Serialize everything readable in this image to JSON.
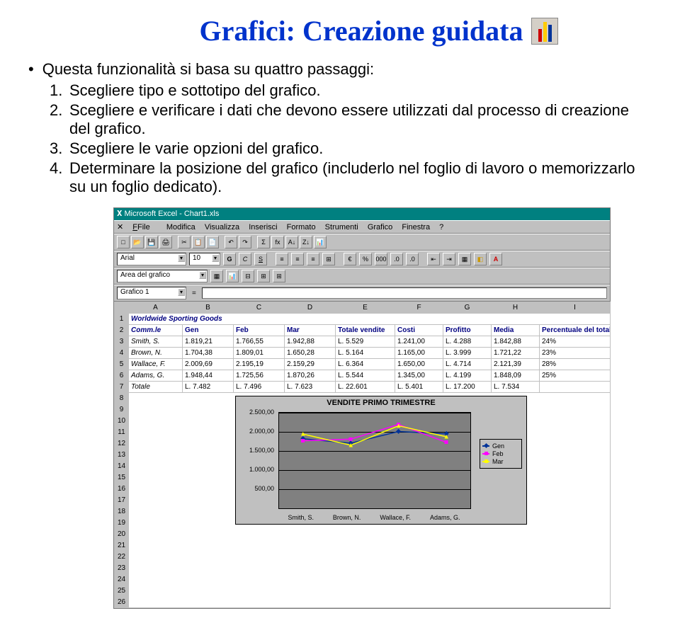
{
  "title": "Grafici: Creazione guidata",
  "intro": "Questa funzionalità si basa su quattro passaggi:",
  "steps": {
    "n1": "1.",
    "t1": "Scegliere tipo e sottotipo del grafico.",
    "n2": "2.",
    "t2": "Scegliere e verificare i dati che devono essere utilizzati dal processo di creazione del grafico.",
    "n3": "3.",
    "t3": "Scegliere le varie opzioni del grafico.",
    "n4": "4.",
    "t4": "Determinare la posizione del grafico (includerlo nel foglio di lavoro o memorizzarlo su un foglio dedicato)."
  },
  "excel": {
    "title": "Microsoft Excel - Chart1.xls",
    "menu": {
      "file": "File",
      "mod": "Modifica",
      "vis": "Visualizza",
      "ins": "Inserisci",
      "form": "Formato",
      "strum": "Strumenti",
      "graf": "Grafico",
      "fin": "Finestra",
      "help": "?"
    },
    "font_name": "Arial",
    "font_size": "10",
    "area_label": "Area del grafico",
    "name_box": "Grafico 1",
    "cols": {
      "a": "A",
      "b": "B",
      "c": "C",
      "d": "D",
      "e": "E",
      "f": "F",
      "g": "G",
      "h": "H",
      "i": "I"
    },
    "r1_a": "Worldwide Sporting Goods",
    "hdr": {
      "a": "Comm.le",
      "b": "Gen",
      "c": "Feb",
      "d": "Mar",
      "e": "Totale vendite",
      "f": "Costi",
      "g": "Profitto",
      "h": "Media",
      "i": "Percentuale del totale"
    },
    "rows": {
      "r3": {
        "a": "Smith, S.",
        "b": "1.819,21",
        "c": "1.766,55",
        "d": "1.942,88",
        "e": "L. 5.529",
        "f": "1.241,00",
        "g": "L. 4.288",
        "h": "1.842,88",
        "i": "24%"
      },
      "r4": {
        "a": "Brown, N.",
        "b": "1.704,38",
        "c": "1.809,01",
        "d": "1.650,28",
        "e": "L. 5.164",
        "f": "1.165,00",
        "g": "L. 3.999",
        "h": "1.721,22",
        "i": "23%"
      },
      "r5": {
        "a": "Wallace, F.",
        "b": "2.009,69",
        "c": "2.195,19",
        "d": "2.159,29",
        "e": "L. 6.364",
        "f": "1.650,00",
        "g": "L. 4.714",
        "h": "2.121,39",
        "i": "28%"
      },
      "r6": {
        "a": "Adams, G.",
        "b": "1.948,44",
        "c": "1.725,56",
        "d": "1.870,26",
        "e": "L. 5.544",
        "f": "1.345,00",
        "g": "L. 4.199",
        "h": "1.848,09",
        "i": "25%"
      },
      "r7": {
        "a": "Totale",
        "b": "L. 7.482",
        "c": "L. 7.496",
        "d": "L. 7.623",
        "e": "L. 22.601",
        "f": "L. 5.401",
        "g": "L. 17.200",
        "h": "L. 7.534",
        "i": ""
      }
    },
    "row_nums": {
      "r1": "1",
      "r2": "2",
      "r3": "3",
      "r4": "4",
      "r5": "5",
      "r6": "6",
      "r7": "7",
      "r8": "8",
      "r9": "9",
      "r10": "10",
      "r11": "11",
      "r12": "12",
      "r13": "13",
      "r14": "14",
      "r15": "15",
      "r16": "16",
      "r17": "17",
      "r18": "18",
      "r19": "19",
      "r20": "20",
      "r21": "21",
      "r22": "22",
      "r23": "23",
      "r24": "24",
      "r25": "25",
      "r26": "26"
    }
  },
  "chart_data": {
    "type": "line",
    "title": "VENDITE PRIMO TRIMESTRE",
    "categories": [
      "Smith, S.",
      "Brown, N.",
      "Wallace, F.",
      "Adams, G."
    ],
    "series": [
      {
        "name": "Gen",
        "values": [
          1819.21,
          1704.38,
          2009.69,
          1948.44
        ],
        "color": "#003399"
      },
      {
        "name": "Feb",
        "values": [
          1766.55,
          1809.01,
          2195.19,
          1725.56
        ],
        "color": "#ff00ff"
      },
      {
        "name": "Mar",
        "values": [
          1942.88,
          1650.28,
          2159.29,
          1870.26
        ],
        "color": "#ffff00"
      }
    ],
    "ylabels": {
      "y0": "500,00",
      "y1": "1.000,00",
      "y2": "1.500,00",
      "y3": "2.000,00",
      "y4": "2.500,00"
    },
    "ylim": [
      0,
      2500
    ],
    "xlabel": "",
    "ylabel": ""
  }
}
